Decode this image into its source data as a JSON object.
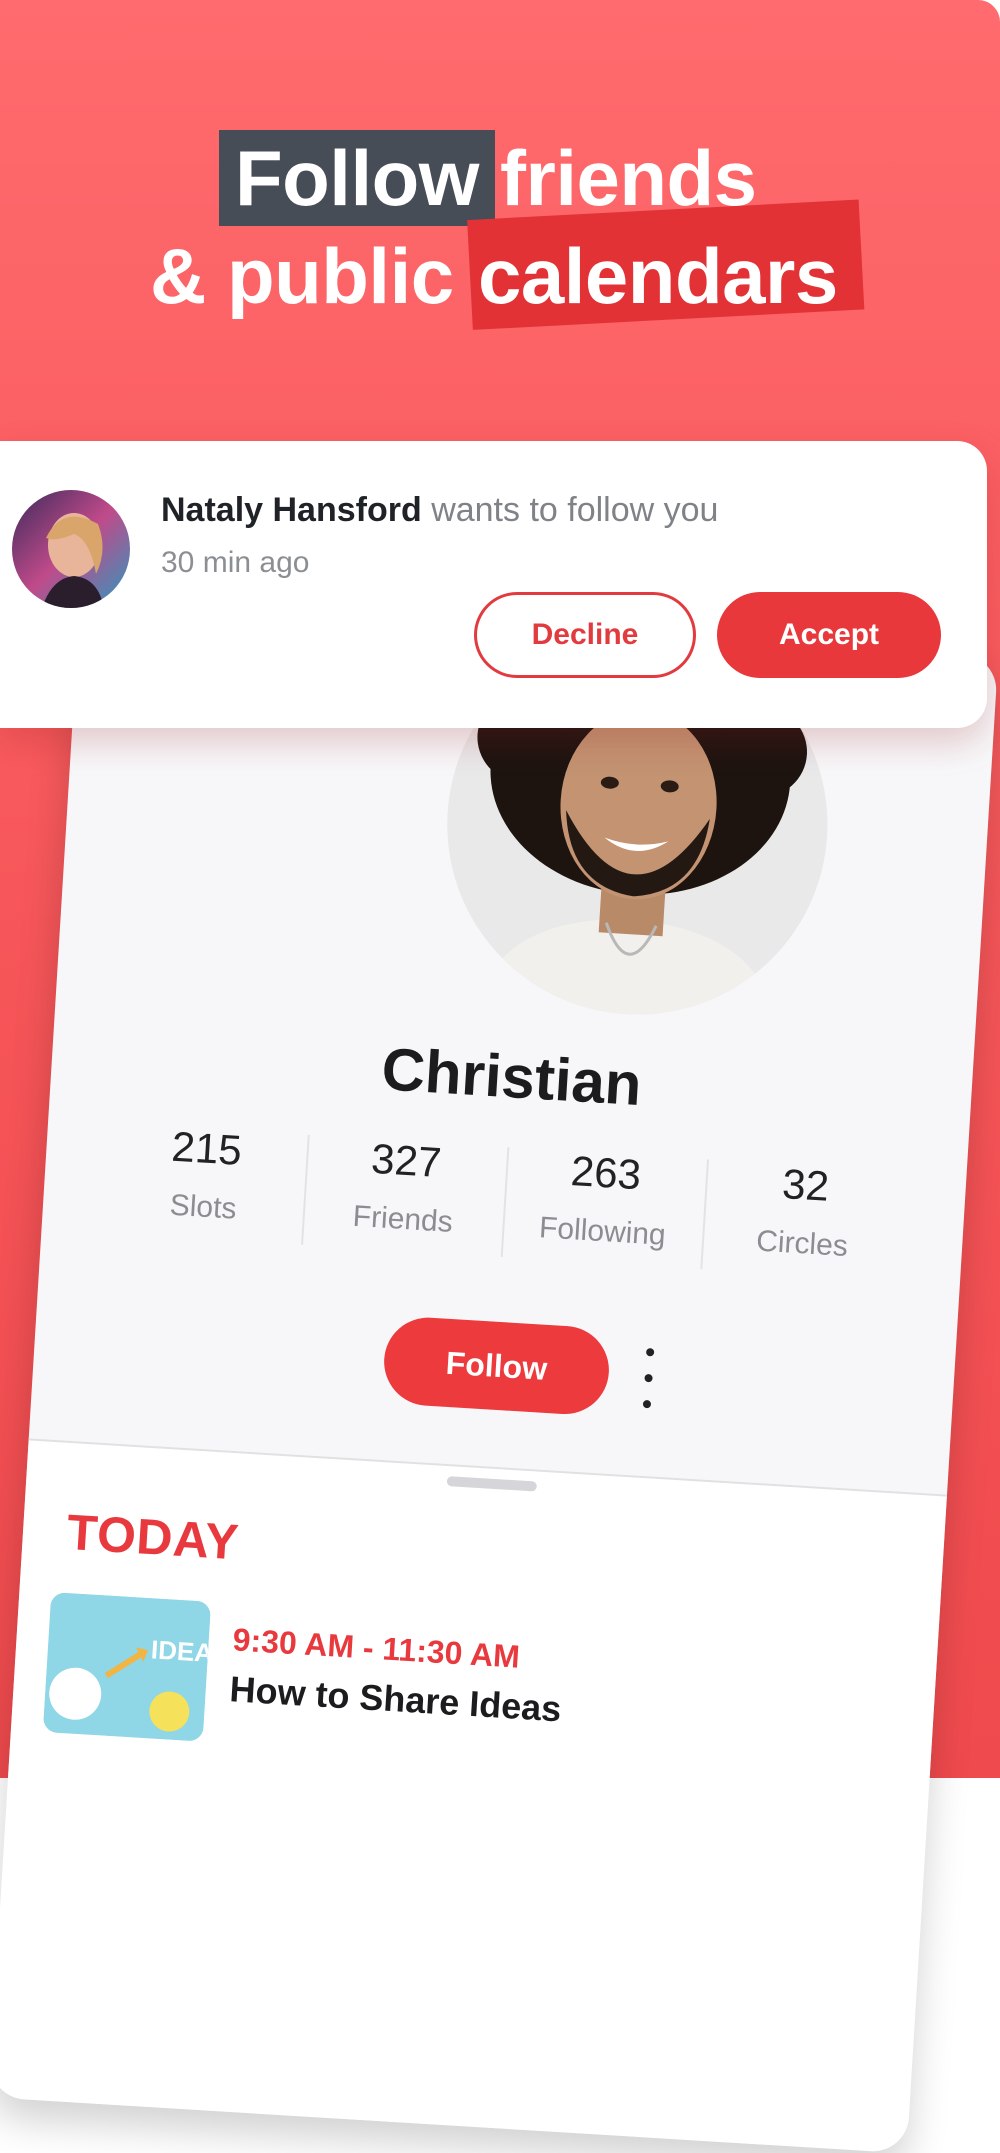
{
  "headline": {
    "word1": "Follow",
    "word2": "friends",
    "word3": "& public",
    "word4": "calendars"
  },
  "notification": {
    "name": "Nataly Hansford",
    "message": "wants to follow you",
    "time": "30 min ago",
    "decline_label": "Decline",
    "accept_label": "Accept"
  },
  "profile": {
    "name": "Christian",
    "stats": [
      {
        "value": "215",
        "label": "Slots"
      },
      {
        "value": "327",
        "label": "Friends"
      },
      {
        "value": "263",
        "label": "Following"
      },
      {
        "value": "32",
        "label": "Circles"
      }
    ],
    "follow_label": "Follow",
    "more_icon": "more-vertical-icon"
  },
  "today": {
    "heading": "TODAY",
    "event": {
      "time": "9:30 AM - 11:30 AM",
      "title": "How to Share Ideas",
      "thumb_text": "IDEA"
    }
  },
  "colors": {
    "accent": "#e8383c",
    "background": "#f65558",
    "highlight_dark": "#464d56"
  }
}
